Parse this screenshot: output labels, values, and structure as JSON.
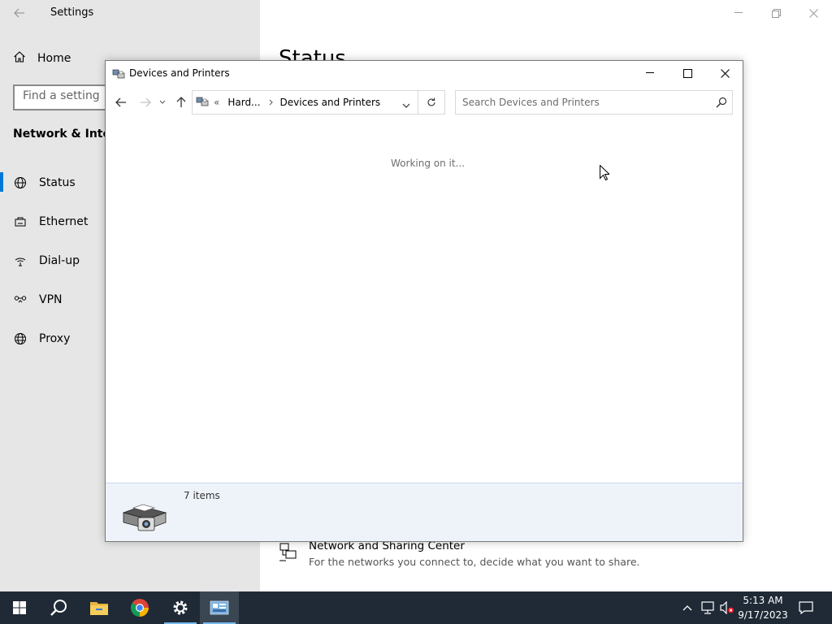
{
  "settings": {
    "title": "Settings",
    "home_label": "Home",
    "search_placeholder": "Find a setting",
    "section_heading": "Network & Internet",
    "nav_items": [
      {
        "label": "Status",
        "icon": "globe-status-icon",
        "active": true
      },
      {
        "label": "Ethernet",
        "icon": "ethernet-icon"
      },
      {
        "label": "Dial-up",
        "icon": "dial-up-icon"
      },
      {
        "label": "VPN",
        "icon": "vpn-icon"
      },
      {
        "label": "Proxy",
        "icon": "globe-icon"
      }
    ],
    "main_title": "Status",
    "network_sharing": {
      "title": "Network and Sharing Center",
      "description": "For the networks you connect to, decide what you want to share."
    }
  },
  "explorer": {
    "title": "Devices and Printers",
    "breadcrumb": [
      "Hard...",
      "Devices and Printers"
    ],
    "breadcrumb_overflow": "«",
    "search_placeholder": "Search Devices and Printers",
    "status_text": "Working on it...",
    "item_count": "7 items"
  },
  "taskbar": {
    "time": "5:13 AM",
    "date": "9/17/2023",
    "apps": [
      "start-icon",
      "search-icon",
      "file-explorer-icon",
      "chrome-icon",
      "settings-gear-icon",
      "devices-printers-icon"
    ]
  },
  "colors": {
    "accent": "#0078d7",
    "sidebar_bg": "#e6e6e6",
    "taskbar_bg": "#1f2a36",
    "details_bg": "#eef3fa"
  }
}
